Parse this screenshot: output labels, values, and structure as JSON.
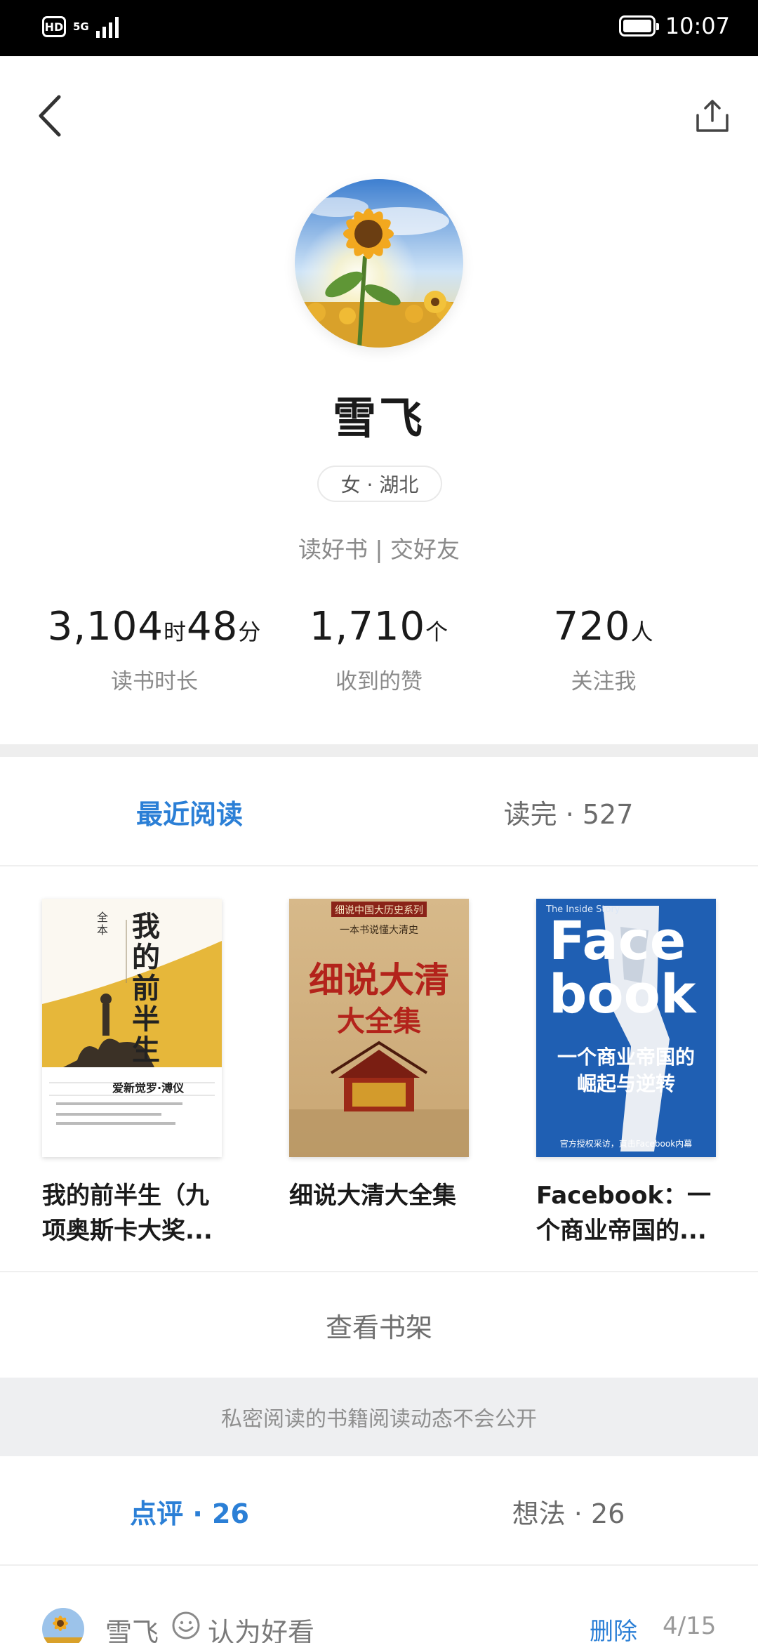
{
  "status_bar": {
    "hd": "HD",
    "network": "5G",
    "time": "10:07"
  },
  "profile": {
    "name": "雪飞",
    "tag": "女 · 湖北",
    "motto": "读好书 | 交好友"
  },
  "stats": [
    {
      "value": "3,104",
      "unit": "时",
      "value2": "48",
      "unit2": "分",
      "label": "读书时长"
    },
    {
      "value": "1,710",
      "unit": "个",
      "label": "收到的赞"
    },
    {
      "value": "720",
      "unit": "人",
      "label": "关注我"
    }
  ],
  "tabs": {
    "recent": "最近阅读",
    "finished": "读完 · 527"
  },
  "books": [
    {
      "title": "我的前半生（九项奥斯卡大奖..."
    },
    {
      "title": "细说大清大全集"
    },
    {
      "title": "Facebook：一个商业帝国的..."
    }
  ],
  "covers": {
    "book1": {
      "big_title": "我的前半生",
      "subtitle": "全本",
      "author": "爱新觉罗·溥仪"
    },
    "book2": {
      "series": "细说中国大历史系列",
      "tagline": "一本书说懂大清史",
      "title_line1": "细说大清",
      "title_line2": "大全集"
    },
    "book3": {
      "small": "The Inside Story",
      "line1": "Face",
      "line2": "book",
      "cn1": "一个商业帝国的",
      "cn2": "崛起与逆转",
      "footer": "官方授权采访，直击Facebook内幕"
    }
  },
  "shelf_button": "查看书架",
  "private_note": "私密阅读的书籍阅读动态不会公开",
  "tabs2": {
    "reviews": "点评 · 26",
    "thoughts": "想法 · 26"
  },
  "review": {
    "name": "雪飞",
    "verdict": "认为好看",
    "delete": "删除",
    "date": "4/15"
  },
  "colors": {
    "accent": "#2b7fd6",
    "status_bar": "#000000",
    "band": "#eeeeee"
  }
}
